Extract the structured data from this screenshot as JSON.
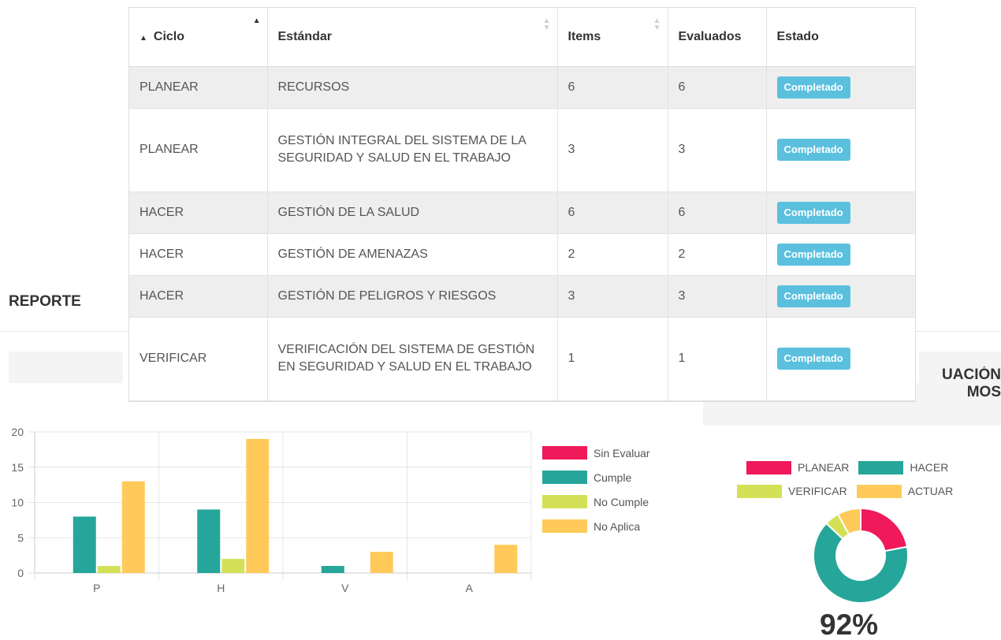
{
  "report": {
    "title": "REPORTE",
    "right_heading_line1": "UACIÓN",
    "right_heading_line2": "MOS"
  },
  "table": {
    "headers": [
      "Ciclo",
      "Estándar",
      "Items",
      "Evaluados",
      "Estado"
    ],
    "rows": [
      {
        "ciclo": "PLANEAR",
        "estandar": "RECURSOS",
        "items": "6",
        "evaluados": "6",
        "estado": "Completado"
      },
      {
        "ciclo": "PLANEAR",
        "estandar": "GESTIÓN INTEGRAL DEL SISTEMA DE LA SEGURIDAD Y SALUD EN EL TRABAJO",
        "items": "3",
        "evaluados": "3",
        "estado": "Completado"
      },
      {
        "ciclo": "HACER",
        "estandar": "GESTIÓN DE LA SALUD",
        "items": "6",
        "evaluados": "6",
        "estado": "Completado"
      },
      {
        "ciclo": "HACER",
        "estandar": "GESTIÓN DE AMENAZAS",
        "items": "2",
        "evaluados": "2",
        "estado": "Completado"
      },
      {
        "ciclo": "HACER",
        "estandar": "GESTIÓN DE PELIGROS Y RIESGOS",
        "items": "3",
        "evaluados": "3",
        "estado": "Completado"
      },
      {
        "ciclo": "VERIFICAR",
        "estandar": "VERIFICACIÓN DEL SISTEMA DE GESTIÓN EN SEGURIDAD Y SALUD EN EL TRABAJO",
        "items": "1",
        "evaluados": "1",
        "estado": "Completado"
      }
    ]
  },
  "chart_data": [
    {
      "type": "bar",
      "categories": [
        "P",
        "H",
        "V",
        "A"
      ],
      "series": [
        {
          "name": "Sin Evaluar",
          "color": "#f0195a",
          "values": [
            0,
            0,
            0,
            0
          ]
        },
        {
          "name": "Cumple",
          "color": "#26a69a",
          "values": [
            8,
            9,
            1,
            0
          ]
        },
        {
          "name": "No Cumple",
          "color": "#d4e157",
          "values": [
            1,
            2,
            0,
            0
          ]
        },
        {
          "name": "No Aplica",
          "color": "#ffca5a",
          "values": [
            13,
            19,
            3,
            4
          ]
        }
      ],
      "ylim": [
        0,
        20
      ],
      "yticks": [
        0,
        5,
        10,
        15,
        20
      ],
      "grid": true,
      "legend": "right"
    },
    {
      "type": "pie",
      "variant": "doughnut",
      "labels": [
        "PLANEAR",
        "HACER",
        "VERIFICAR",
        "ACTUAR"
      ],
      "colors": [
        "#f0195a",
        "#26a69a",
        "#d4e157",
        "#ffca5a"
      ],
      "values": [
        22,
        65,
        5,
        8
      ],
      "legend": "top",
      "center_label": "92%"
    }
  ]
}
